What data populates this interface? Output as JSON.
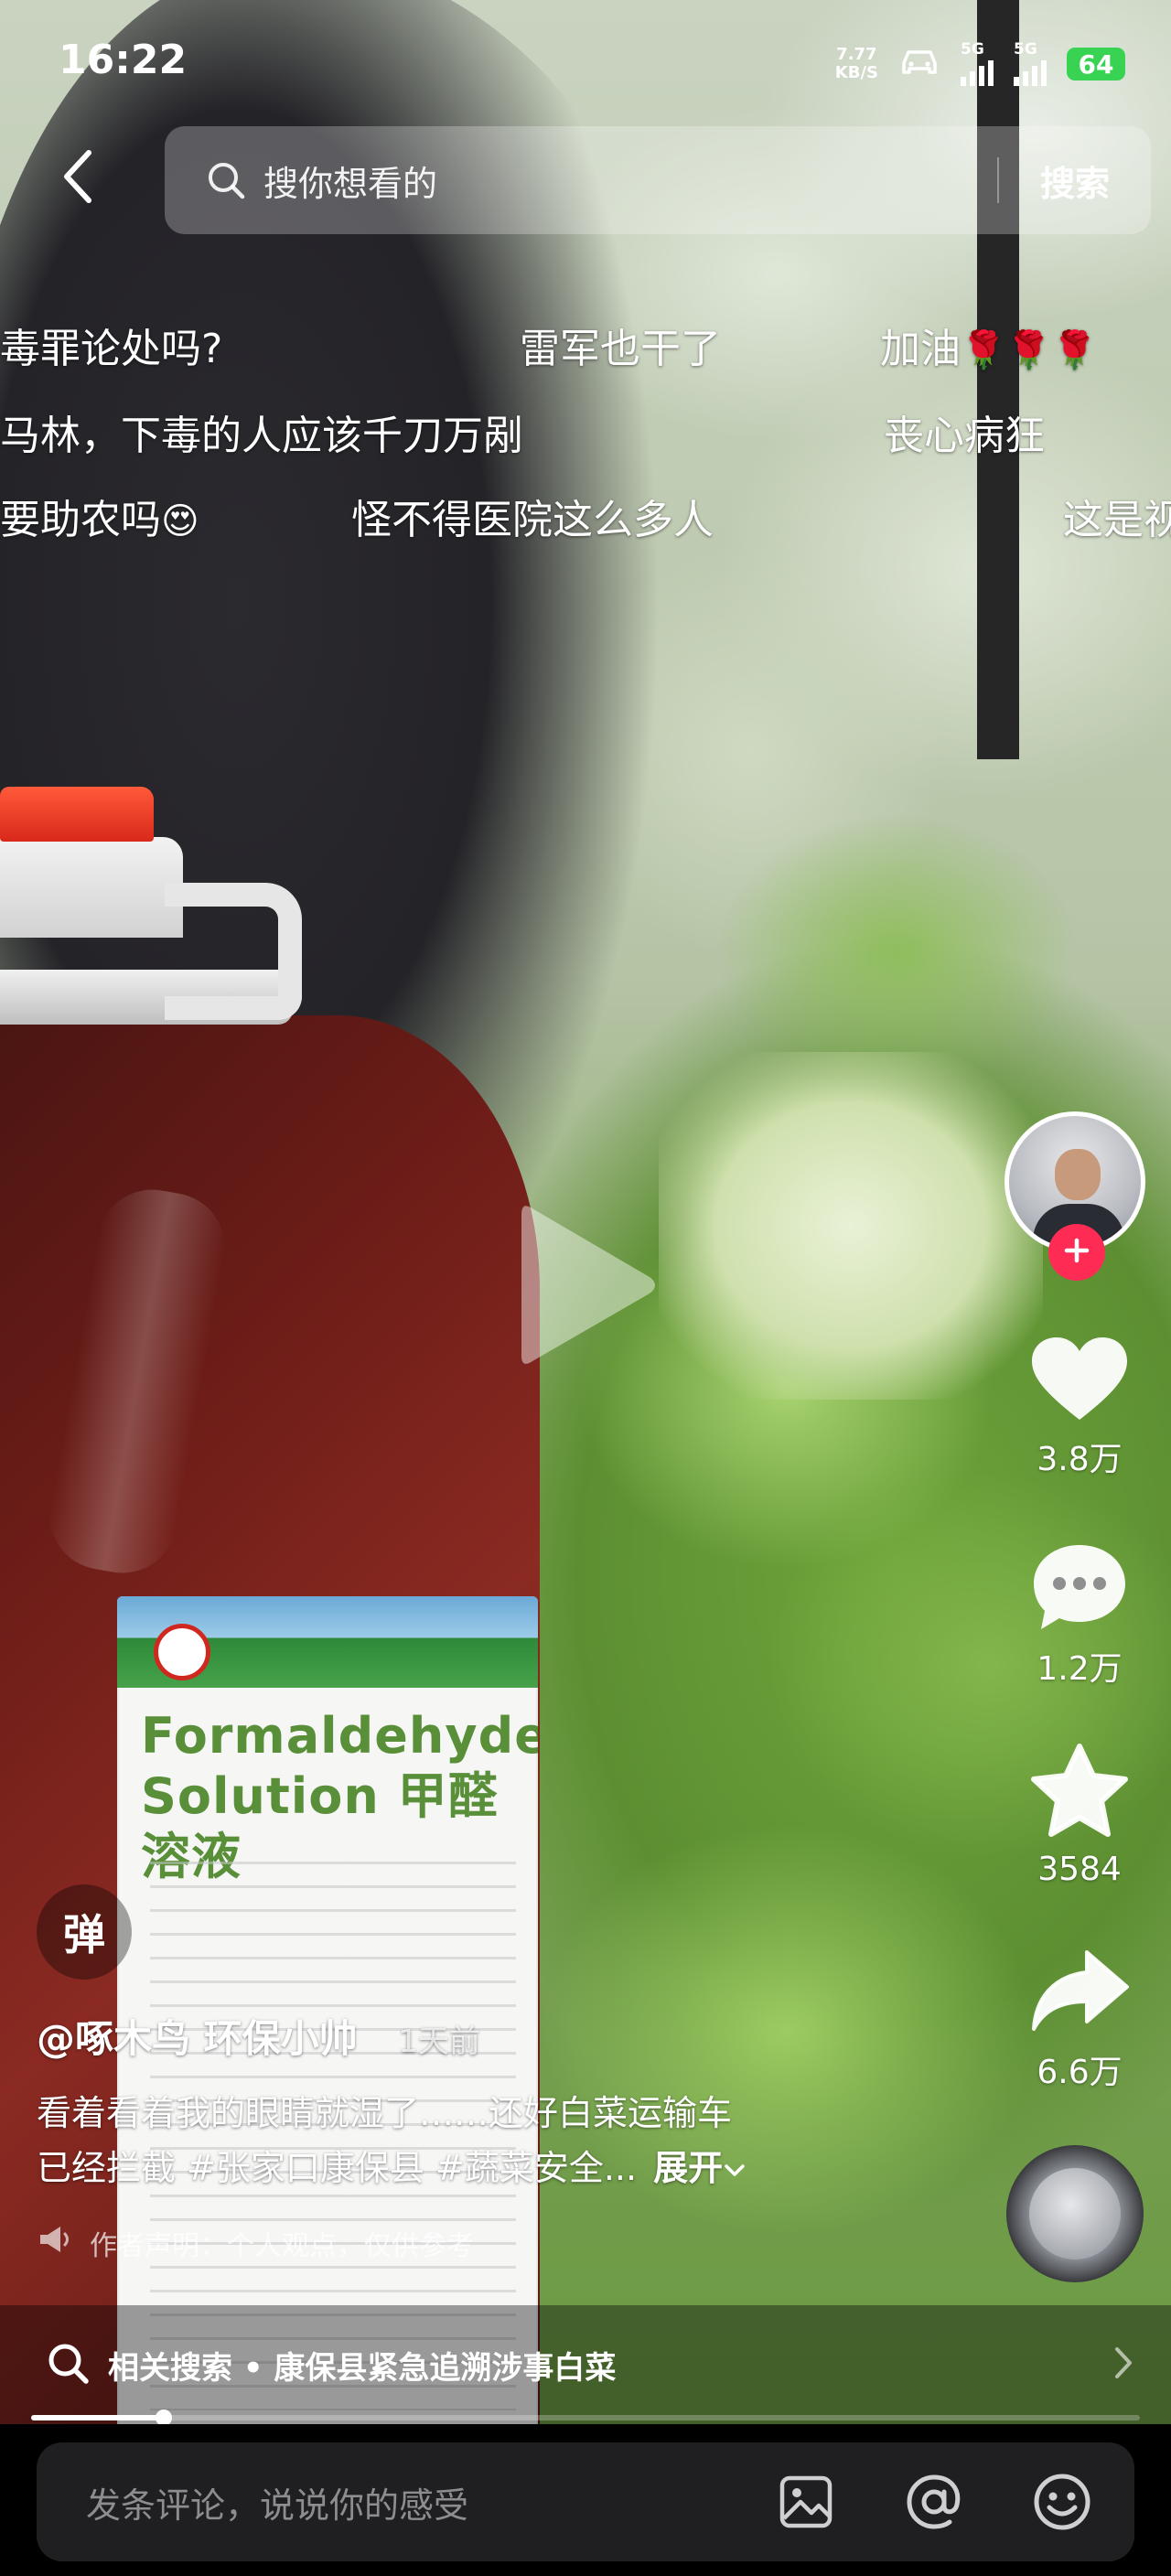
{
  "status_bar": {
    "time": "16:22",
    "net_speed_value": "7.77",
    "net_speed_unit": "KB/S",
    "sim1_tag": "5G",
    "sim2_tag": "5G",
    "battery": "64"
  },
  "search": {
    "placeholder": "搜你想看的",
    "button_label": "搜索"
  },
  "danmaku": [
    {
      "text": "毒罪论处吗?"
    },
    {
      "text": "雷军也干了"
    },
    {
      "text": "加油",
      "emoji": "🌹🌹🌹"
    },
    {
      "text": "马林，下毒的人应该千刀万剐"
    },
    {
      "text": "丧心病狂"
    },
    {
      "text": "要助农吗",
      "emoji": "😍"
    },
    {
      "text": "怪不得医院这么多人"
    },
    {
      "text": "这是视"
    }
  ],
  "bottle_label": {
    "name_line1": "Formaldehyde",
    "name_line2": "Solution 甲醛溶液"
  },
  "rail": {
    "likes": "3.8万",
    "comments": "1.2万",
    "favorites": "3584",
    "shares": "6.6万"
  },
  "post": {
    "danmu_toggle_label": "弹",
    "author": "@啄木鸟 环保小帅",
    "time_ago": "1天前",
    "caption_line1": "看着看着我的眼睛就湿了……还好白菜运输车",
    "caption_line2": "已经拦截 #张家口康保县 #蔬菜安全...",
    "expand_label": "展开",
    "disclaimer": "作者声明：个人观点，仅供参考"
  },
  "related": {
    "label": "相关搜索",
    "separator": "•",
    "query": "康保县紧急追溯涉事白菜"
  },
  "progress": {
    "fraction": 0.12
  },
  "comment": {
    "placeholder": "发条评论，说说你的感受"
  },
  "colors": {
    "accent_red": "#fe2c55",
    "battery_green": "#39d353"
  },
  "icons": {
    "back": "chevron-left-icon",
    "search": "search-icon",
    "like": "heart-icon",
    "comment": "comment-bubble-icon",
    "favorite": "star-icon",
    "share": "share-arrow-icon",
    "play": "play-icon",
    "image": "image-icon",
    "mention": "at-icon",
    "emoji": "emoji-icon"
  }
}
